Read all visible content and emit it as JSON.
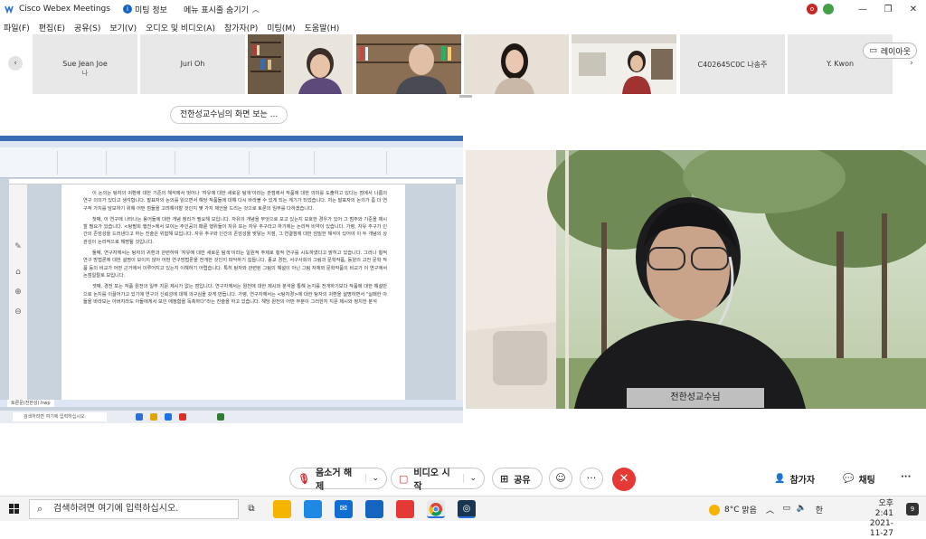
{
  "titlebar": {
    "app_title": "Cisco Webex Meetings",
    "meeting_info": "미팅 정보",
    "hide_menu": "메뉴 표시줄 숨기기",
    "user_initial": "o"
  },
  "menu": [
    "파일(F)",
    "편집(E)",
    "공유(S)",
    "보기(V)",
    "오디오 및 비디오(A)",
    "참가자(P)",
    "미팅(M)",
    "도움말(H)"
  ],
  "participants": [
    {
      "name": "Sue Jean Joe",
      "sub": "나",
      "video": false
    },
    {
      "name": "Juri Oh",
      "sub": "",
      "video": false
    },
    {
      "name": "",
      "sub": "",
      "video": true
    },
    {
      "name": "",
      "sub": "",
      "video": true
    },
    {
      "name": "",
      "sub": "",
      "video": true
    },
    {
      "name": "",
      "sub": "",
      "video": true
    },
    {
      "name": "C402645C0C 나송주",
      "sub": "",
      "video": false
    },
    {
      "name": "Y. Kwon",
      "sub": "",
      "video": false
    }
  ],
  "layout_button": "레이아웃",
  "share_label": "전한성교수님의 화면 보는 ...",
  "document": {
    "tab_label": "토론문(전한성).hwp",
    "inner_search": "검색하려면 여기에 입력하십시오.",
    "paragraphs": [
      "이 논의는 탕자의 귀환에 대한 기존의 해석에서 벗어나 '자유에 대한 새로운 탐색'이라는 관점에서 작품에 대한 의미를 도출하고 있다는 점에서 나름의 연구 의의가 있다고 생각합니다. 발표자의 논의를 읽으면서 해당 작품들에 대해 다시 바라볼 수 있게 되는 계기가 되었습니다. 저는 발표자의 논의가 좀 더 연구적 가치를 담보하기 위해 어떤 점들을 고려해야할 것인지 몇 가지 제언을 드리는 것으로 토론의 임무를 다하겠습니다.",
      "첫째, 이 연구에 나타나는 용어들에 대한 개념 정리가 필요해 보입니다. 자유의 개념을 무엇으로 보고 있는지 모호한 경우가 있어 그 범주와 기준을 제시할 필요가 있습니다. <탕필회 행전>에서 보이는 주인공의 패륜 행위들이 자유 또는 자유 추구라고 하기에는 논리적 비약이 있습니다. 가령, 자유 추구가 인간의 존엄성을 드러낸다고 하는 진술은 위험해 보입니다. 자유 추구와 인간의 존엄성을 맞닿는 지점, 그 연결점에 대한 엄밀한 해석이 있어야 이 두 개념의 상관성이 논리적으로 해명될 것입니다.",
      "둘째, 연구자께서는 탕자의 귀환과 관련하여 '자유에 대한 새로운 탐색'이라는 일원적 주제로 횡적 연구를 시도하였다고 밝히고 있습니다. 그러나 횡적 연구 방법론에 대한 설명이 보이지 않아 어떤 연구방법론을 전개한 것인지 파악하기 힘듭니다. 종교 경전, 서구사회의 그림과 문학작품, 동양의 고전 문학 작품 등의 비교가 어떤 근거에서 이루어지고 있는지 이해하기 어렵습니다. 특히 탕자와 관련된 그림의 해설이 아닌 그림 자체와 문학작품의 비교가 이 연구에서 논점일탈로 보입니다.",
      "셋째, 경전 또는 작품 원전의 일부 지문 제시가 없는 점입니다. 연구자께서는 원전에 대한 제시와 분석을 통해 논지를 전개하기보다 작품에 대한 해설만으로 논지를 이끌어가고 있기에 연구의 신뢰성에 대해 의구심을 갖게 만듭니다. 가령, 연구자께서는 <탕자경>에 대한 탕자의 귀환을 설명하면서 \"실패한 아들을 바라보는 아버지라도 아들에게서 보인 애정함을 독촉하다\"라는 진술을 하고 있습니다. 해당 원전의 어떤 부분이 그러한지 지문 제시와 정치한 분석"
    ]
  },
  "speaker_label": "전한성교수님",
  "controls": {
    "mute": "음소거 해제",
    "video": "비디오 시작",
    "share": "공유",
    "participants": "참가자",
    "chat": "채팅"
  },
  "taskbar": {
    "search_placeholder": "검색하려면 여기에 입력하십시오.",
    "weather_temp": "8°C",
    "weather_text": "맑음",
    "ime": "한",
    "time": "오후 2:41",
    "date": "2021-11-27",
    "notifications": "9"
  }
}
